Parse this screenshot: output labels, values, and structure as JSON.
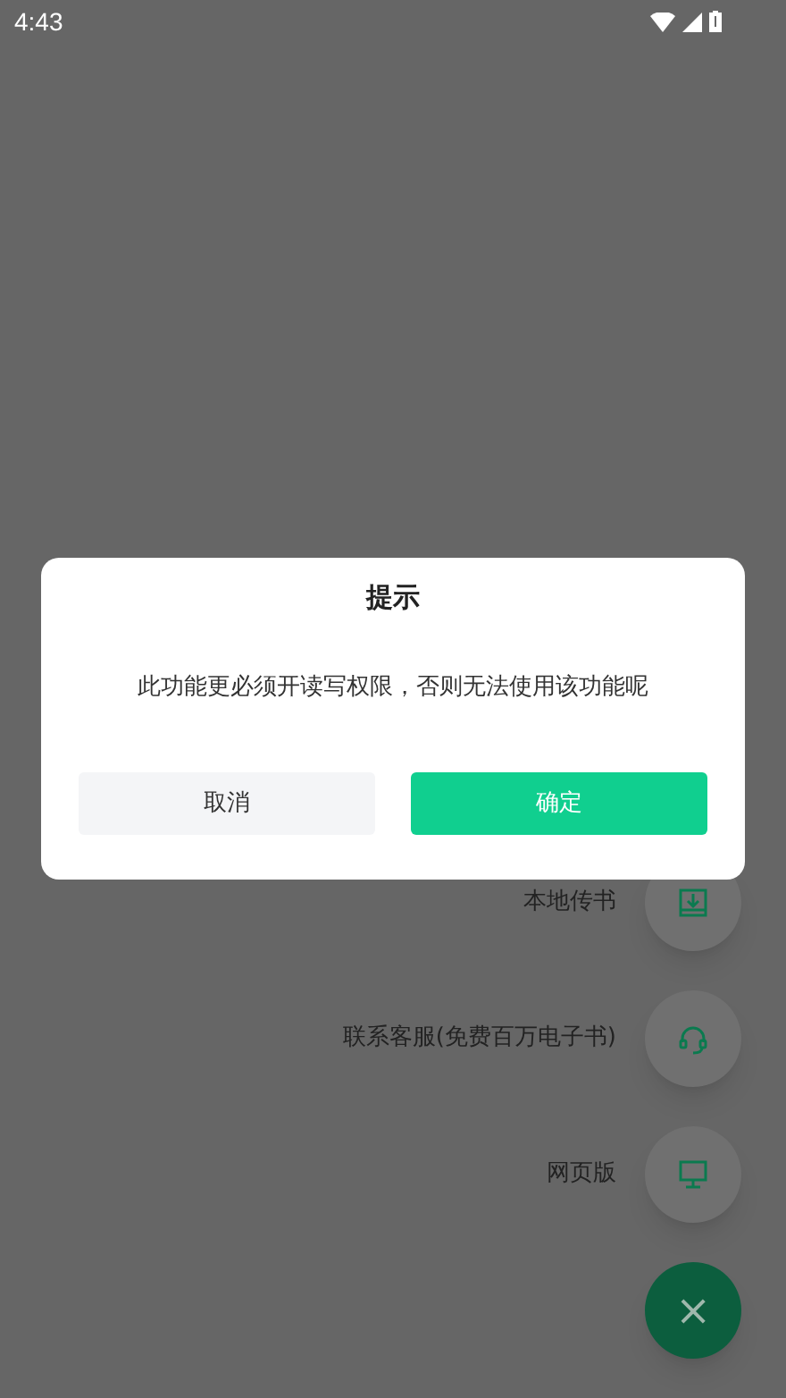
{
  "status_bar": {
    "time": "4:43"
  },
  "fab_menu": {
    "items": [
      {
        "label": "本地传书",
        "kind": "download"
      },
      {
        "label": "联系客服(免费百万电子书)",
        "kind": "headset"
      },
      {
        "label": "网页版",
        "kind": "monitor"
      }
    ],
    "close_label": "×"
  },
  "dialog": {
    "title": "提示",
    "message": "此功能更必须开读写权限，否则无法使用该功能呢",
    "buttons": [
      {
        "label": "取消",
        "kind": "secondary"
      },
      {
        "label": "确定",
        "kind": "primary"
      }
    ]
  }
}
